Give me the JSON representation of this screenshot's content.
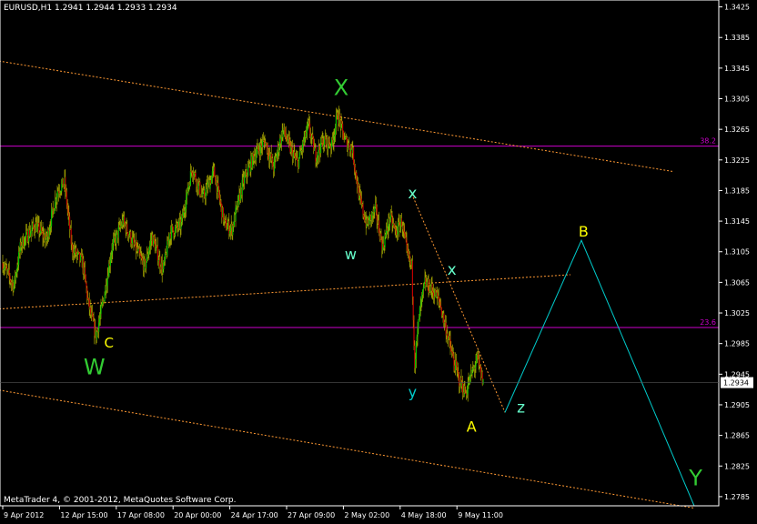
{
  "header": {
    "symbol": "EURUSD,H1",
    "ohlc": "1.2941 1.2944 1.2933 1.2934"
  },
  "footer": {
    "copyright": "MetaTrader 4, © 2001-2012, MetaQuotes Software Corp."
  },
  "colors": {
    "background": "#000000",
    "axis": "#ffffff",
    "bull_candle": "#00c000",
    "bear_candle": "#c00000",
    "wick": "#c0c000",
    "channel_line": "#ff9933",
    "fibo_line": "#cc00cc",
    "forecast_line": "#00cccc",
    "label_green": "#33cc33",
    "label_yellow": "#ffff00",
    "label_cyan": "#00cccc",
    "label_mint": "#66ffcc"
  },
  "chart_data": {
    "type": "candlestick",
    "symbol": "EURUSD",
    "timeframe": "H1",
    "current_price": "1.2934",
    "ylim": [
      1.2773,
      1.3434
    ],
    "y_ticks": [
      "1.3425",
      "1.3385",
      "1.3345",
      "1.3305",
      "1.3265",
      "1.3225",
      "1.3185",
      "1.3145",
      "1.3105",
      "1.3065",
      "1.3025",
      "1.2985",
      "1.2945",
      "1.2905",
      "1.2865",
      "1.2825",
      "1.2785"
    ],
    "x_ticks": [
      {
        "label": "9 Apr 2012",
        "bar": 0
      },
      {
        "label": "12 Apr 15:00",
        "bar": 78
      },
      {
        "label": "17 Apr 08:00",
        "bar": 156
      },
      {
        "label": "20 Apr 00:00",
        "bar": 234
      },
      {
        "label": "24 Apr 17:00",
        "bar": 312
      },
      {
        "label": "27 Apr 09:00",
        "bar": 390
      },
      {
        "label": "2 May 02:00",
        "bar": 468
      },
      {
        "label": "4 May 18:00",
        "bar": 546
      },
      {
        "label": "9 May 11:00",
        "bar": 624
      }
    ],
    "bars_total": 660,
    "bars_forecast_span": 920,
    "price_path": [
      [
        0,
        1.309
      ],
      [
        15,
        1.306
      ],
      [
        25,
        1.3115
      ],
      [
        45,
        1.314
      ],
      [
        60,
        1.312
      ],
      [
        75,
        1.3185
      ],
      [
        85,
        1.3195
      ],
      [
        95,
        1.311
      ],
      [
        110,
        1.309
      ],
      [
        118,
        1.3035
      ],
      [
        128,
        1.2995
      ],
      [
        138,
        1.304
      ],
      [
        150,
        1.311
      ],
      [
        165,
        1.3145
      ],
      [
        180,
        1.3115
      ],
      [
        195,
        1.3085
      ],
      [
        205,
        1.3125
      ],
      [
        220,
        1.308
      ],
      [
        230,
        1.313
      ],
      [
        245,
        1.314
      ],
      [
        260,
        1.3215
      ],
      [
        275,
        1.3175
      ],
      [
        290,
        1.321
      ],
      [
        305,
        1.314
      ],
      [
        315,
        1.3135
      ],
      [
        330,
        1.3195
      ],
      [
        345,
        1.323
      ],
      [
        360,
        1.325
      ],
      [
        372,
        1.3215
      ],
      [
        385,
        1.3265
      ],
      [
        395,
        1.324
      ],
      [
        405,
        1.322
      ],
      [
        420,
        1.327
      ],
      [
        430,
        1.323
      ],
      [
        440,
        1.325
      ],
      [
        452,
        1.3245
      ],
      [
        460,
        1.3285
      ],
      [
        470,
        1.325
      ],
      [
        480,
        1.324
      ],
      [
        490,
        1.3175
      ],
      [
        500,
        1.314
      ],
      [
        512,
        1.316
      ],
      [
        522,
        1.311
      ],
      [
        532,
        1.315
      ],
      [
        540,
        1.313
      ],
      [
        548,
        1.3145
      ],
      [
        556,
        1.31
      ],
      [
        562,
        1.3085
      ],
      [
        566,
        1.296
      ],
      [
        572,
        1.302
      ],
      [
        580,
        1.3065
      ],
      [
        590,
        1.3055
      ],
      [
        600,
        1.304
      ],
      [
        610,
        1.3
      ],
      [
        620,
        1.296
      ],
      [
        628,
        1.2935
      ],
      [
        636,
        1.292
      ],
      [
        644,
        1.2945
      ],
      [
        652,
        1.2965
      ],
      [
        660,
        1.2934
      ]
    ],
    "channel_lines": [
      {
        "from": [
          -10,
          1.3355
        ],
        "to": [
          920,
          1.321
        ]
      },
      {
        "from": [
          -10,
          1.303
        ],
        "to": [
          780,
          1.3075
        ]
      },
      {
        "from": [
          -10,
          1.2925
        ],
        "to": [
          950,
          1.277
        ]
      }
    ],
    "fibo_levels": [
      {
        "label": "38.2",
        "price": 1.3243
      },
      {
        "label": "23.6",
        "price": 1.3006
      }
    ],
    "wedge_line": {
      "from": [
        560,
        1.3185
      ],
      "to": [
        690,
        1.2895
      ]
    },
    "forecast_path": [
      [
        690,
        1.2895
      ],
      [
        795,
        1.312
      ],
      [
        950,
        1.2773
      ]
    ],
    "wave_labels": [
      {
        "text": "X",
        "bar": 465,
        "price": 1.331,
        "color": "label_green",
        "size": 24
      },
      {
        "text": "W",
        "bar": 126,
        "price": 1.2945,
        "color": "label_green",
        "size": 24
      },
      {
        "text": "C",
        "bar": 146,
        "price": 1.298,
        "color": "label_yellow",
        "size": 15
      },
      {
        "text": "w",
        "bar": 478,
        "price": 1.3095,
        "color": "label_mint",
        "size": 16
      },
      {
        "text": "x",
        "bar": 563,
        "price": 1.3175,
        "color": "label_mint",
        "size": 17
      },
      {
        "text": "x",
        "bar": 617,
        "price": 1.3075,
        "color": "label_mint",
        "size": 17
      },
      {
        "text": "y",
        "bar": 563,
        "price": 1.2915,
        "color": "label_cyan",
        "size": 16
      },
      {
        "text": "z",
        "bar": 712,
        "price": 1.2895,
        "color": "label_mint",
        "size": 17
      },
      {
        "text": "A",
        "bar": 644,
        "price": 1.287,
        "color": "label_yellow",
        "size": 16
      },
      {
        "text": "B",
        "bar": 798,
        "price": 1.3125,
        "color": "label_yellow",
        "size": 16
      },
      {
        "text": "Y",
        "bar": 952,
        "price": 1.28,
        "color": "label_green",
        "size": 24
      }
    ]
  }
}
